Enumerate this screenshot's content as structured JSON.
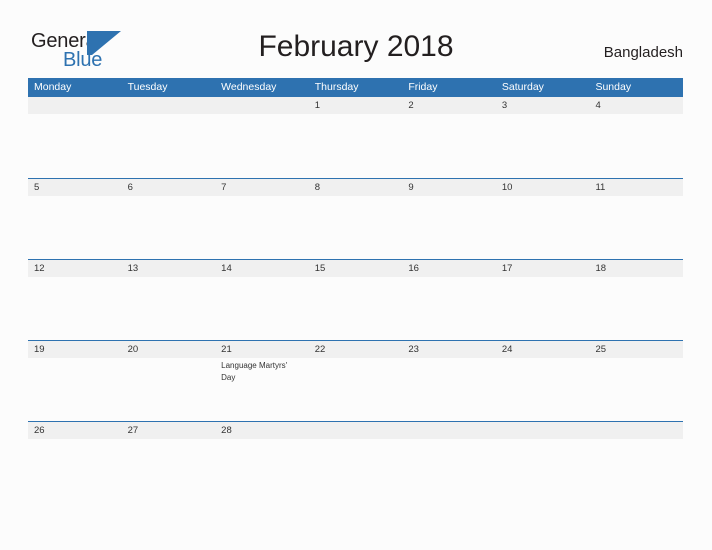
{
  "brand": {
    "word_one": "General",
    "word_two": "Blue",
    "flag_icon": "blue-flag-icon",
    "accent_color": "#2e72b0"
  },
  "header": {
    "title": "February 2018",
    "country": "Bangladesh"
  },
  "calendar": {
    "weekday_headers": [
      "Monday",
      "Tuesday",
      "Wednesday",
      "Thursday",
      "Friday",
      "Saturday",
      "Sunday"
    ],
    "header_bg": "#2e72b0",
    "band_bg": "#f0f0f0",
    "weeks": [
      [
        {
          "day": "",
          "events": []
        },
        {
          "day": "",
          "events": []
        },
        {
          "day": "",
          "events": []
        },
        {
          "day": "1",
          "events": []
        },
        {
          "day": "2",
          "events": []
        },
        {
          "day": "3",
          "events": []
        },
        {
          "day": "4",
          "events": []
        }
      ],
      [
        {
          "day": "5",
          "events": []
        },
        {
          "day": "6",
          "events": []
        },
        {
          "day": "7",
          "events": []
        },
        {
          "day": "8",
          "events": []
        },
        {
          "day": "9",
          "events": []
        },
        {
          "day": "10",
          "events": []
        },
        {
          "day": "11",
          "events": []
        }
      ],
      [
        {
          "day": "12",
          "events": []
        },
        {
          "day": "13",
          "events": []
        },
        {
          "day": "14",
          "events": []
        },
        {
          "day": "15",
          "events": []
        },
        {
          "day": "16",
          "events": []
        },
        {
          "day": "17",
          "events": []
        },
        {
          "day": "18",
          "events": []
        }
      ],
      [
        {
          "day": "19",
          "events": []
        },
        {
          "day": "20",
          "events": []
        },
        {
          "day": "21",
          "events": [
            "Language Martyrs' Day"
          ]
        },
        {
          "day": "22",
          "events": []
        },
        {
          "day": "23",
          "events": []
        },
        {
          "day": "24",
          "events": []
        },
        {
          "day": "25",
          "events": []
        }
      ],
      [
        {
          "day": "26",
          "events": []
        },
        {
          "day": "27",
          "events": []
        },
        {
          "day": "28",
          "events": []
        },
        {
          "day": "",
          "events": []
        },
        {
          "day": "",
          "events": []
        },
        {
          "day": "",
          "events": []
        },
        {
          "day": "",
          "events": []
        }
      ]
    ]
  }
}
